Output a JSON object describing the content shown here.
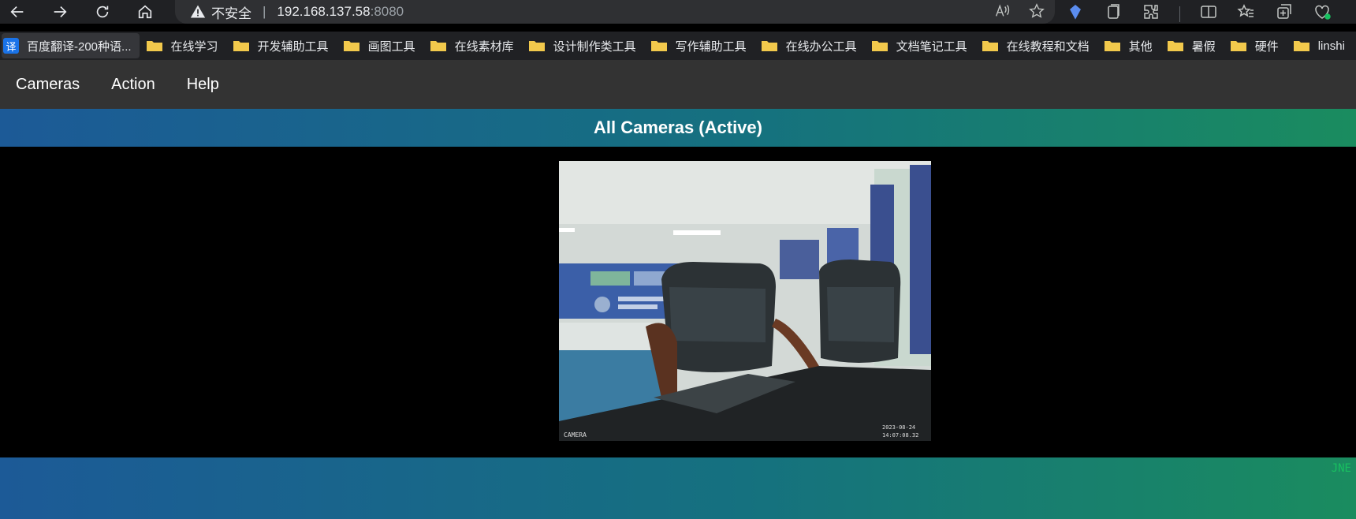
{
  "browser": {
    "insecure_label": "不安全",
    "separator": "|",
    "host": "192.168.137.58",
    "port": ":8080"
  },
  "bookmarks": [
    {
      "label": "百度翻译-200种语...",
      "icon": "translate-icon"
    },
    {
      "label": "在线学习",
      "icon": "folder-icon"
    },
    {
      "label": "开发辅助工具",
      "icon": "folder-icon"
    },
    {
      "label": "画图工具",
      "icon": "folder-icon"
    },
    {
      "label": "在线素材库",
      "icon": "folder-icon"
    },
    {
      "label": "设计制作类工具",
      "icon": "folder-icon"
    },
    {
      "label": "写作辅助工具",
      "icon": "folder-icon"
    },
    {
      "label": "在线办公工具",
      "icon": "folder-icon"
    },
    {
      "label": "文档笔记工具",
      "icon": "folder-icon"
    },
    {
      "label": "在线教程和文档",
      "icon": "folder-icon"
    },
    {
      "label": "其他",
      "icon": "folder-icon"
    },
    {
      "label": "暑假",
      "icon": "folder-icon"
    },
    {
      "label": "硬件",
      "icon": "folder-icon"
    },
    {
      "label": "linshi",
      "icon": "folder-icon"
    }
  ],
  "translate_glyph": "译",
  "nav": {
    "cameras": "Cameras",
    "action": "Action",
    "help": "Help"
  },
  "banner": {
    "title": "All Cameras (Active)"
  },
  "camera": {
    "caption_left": "CAMERA",
    "caption_right_1": "2023-08-24",
    "caption_right_2": "14:07:08.32"
  },
  "footer": {
    "mark": "JNE"
  },
  "colors": {
    "nav_bg": "#333333",
    "gradient_start": "#1c5a97",
    "gradient_end": "#1a8c5f"
  }
}
